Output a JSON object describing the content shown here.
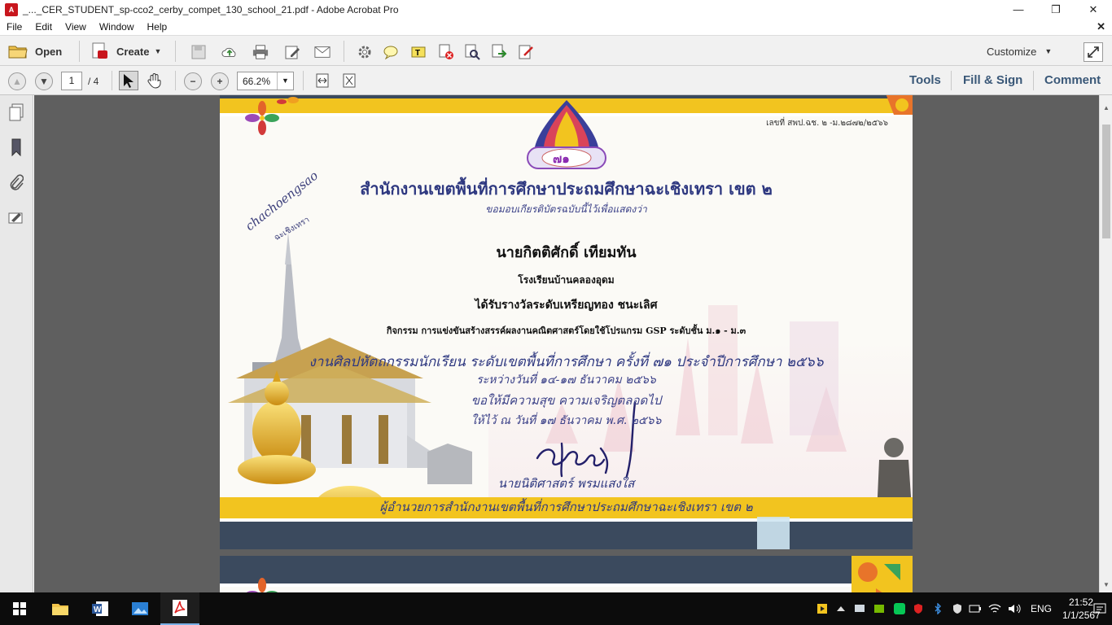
{
  "window": {
    "title": "_..._CER_STUDENT_sp-cco2_cerby_compet_130_school_21.pdf - Adobe Acrobat Pro",
    "minimize": "—",
    "restore": "❐",
    "close": "✕"
  },
  "menu": {
    "items": [
      "File",
      "Edit",
      "View",
      "Window",
      "Help"
    ],
    "close_doc": "✕"
  },
  "toolbar": {
    "open_label": "Open",
    "create_label": "Create",
    "customize_label": "Customize"
  },
  "nav": {
    "page_current": "1",
    "page_total": "/ 4",
    "zoom": "66.2%",
    "tools_label": "Tools",
    "fill_sign_label": "Fill & Sign",
    "comment_label": "Comment"
  },
  "certificate": {
    "doc_number": "เลขที่ สพป.ฉช. ๒ -ม.๒๘๗๒/๒๕๖๖",
    "emblem_number": "๗๑",
    "org_title": "สำนักงานเขตพื้นที่การศึกษาประถมศึกษาฉะเชิงเทรา เขต ๒",
    "subtitle": "ขอมอบเกียรติบัตรฉบับนี้ไว้เพื่อแสดงว่า",
    "student_name": "นายกิตติศักดิ์ เทียมทัน",
    "school": "โรงเรียนบ้านคลองอุดม",
    "award": "ได้รับรางวัลระดับเหรียญทอง ชนะเลิศ",
    "activity": "กิจกรรม การแข่งขันสร้างสรรค์ผลงานคณิตศาสตร์โดยใช้โปรแกรม GSP ระดับชั้น ม.๑ - ม.๓",
    "event": "งานศิลปหัตถกรรมนักเรียน ระดับเขตพื้นที่การศึกษา ครั้งที่ ๗๑ ประจำปีการศึกษา ๒๕๖๖",
    "dates": "ระหว่างวันที่ ๑๔-๑๗ ธันวาคม ๒๕๖๖",
    "wish": "ขอให้มีความสุข ความเจริญตลอดไป",
    "given": "ให้ไว้ ณ วันที่ ๑๗ ธันวาคม พ.ศ. ๒๕๖๖",
    "signer": "นายนิติศาสตร์ พรมแสงใส",
    "position": "ผู้อำนวยการสำนักงานเขตพื้นที่การศึกษาประถมศึกษาฉะเชิงเทรา เขต ๒",
    "cursive_en": "chachoengsao",
    "cursive_th": "ฉะเชิงเทรา"
  },
  "taskbar": {
    "lang": "ENG",
    "time": "21:52",
    "date": "1/1/2567"
  },
  "colors": {
    "toolbar_bg": "#f1f1f1",
    "doc_bg": "#5f5f5f",
    "cert_navy": "#2e3880",
    "cert_gold": "#f2c41f",
    "cert_slate": "#3b4a5e",
    "panel_blue": "#3a5878"
  }
}
